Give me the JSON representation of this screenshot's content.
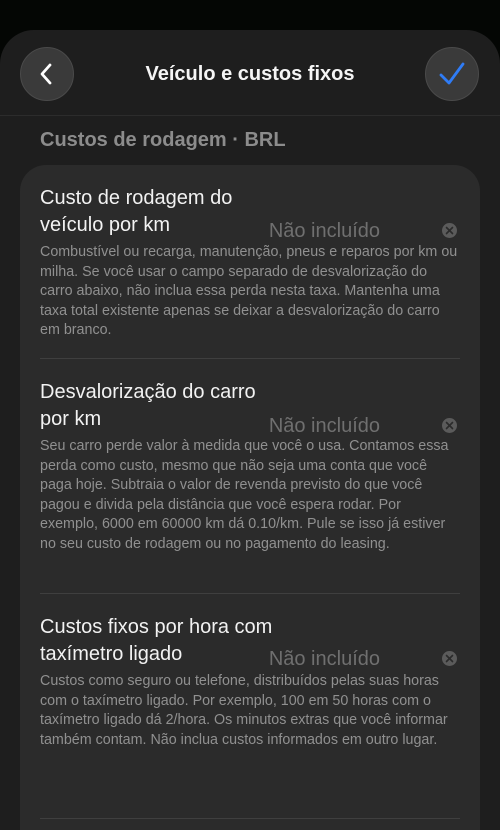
{
  "header": {
    "title": "Veículo e custos fixos",
    "back_icon": "chevron-left-icon",
    "confirm_icon": "checkmark-icon",
    "accent_color": "#2f7cf6"
  },
  "section": {
    "title": "Custos de rodagem · BRL"
  },
  "rows": [
    {
      "label": "Custo de rodagem do veículo por km",
      "value": "Não incluído",
      "description": "Combustível ou recarga, manutenção, pneus e reparos por km ou milha. Se você usar o campo separado de desvalorização do carro abaixo, não inclua essa perda nesta taxa. Mantenha uma taxa total existente apenas se deixar a desvalorização do carro em branco."
    },
    {
      "label": "Desvalorização do carro por km",
      "value": "Não incluído",
      "description": "Seu carro perde valor à medida que você o usa. Contamos essa perda como custo, mesmo que não seja uma conta que você paga hoje. Subtraia o valor de revenda previsto do que você pagou e divida pela distância que você espera rodar. Por exemplo, 6000 em 60000 km dá 0.10/km. Pule se isso já estiver no seu custo de rodagem ou no pagamento do leasing."
    },
    {
      "label": "Custos fixos por hora com taxímetro ligado",
      "value": "Não incluído",
      "description": "Custos como seguro ou telefone, distribuídos pelas suas horas com o taxímetro ligado. Por exemplo, 100 em 50 horas com o taxímetro ligado dá 2/hora. Os minutos extras que você informar também contam. Não inclua custos informados em outro lugar."
    }
  ]
}
